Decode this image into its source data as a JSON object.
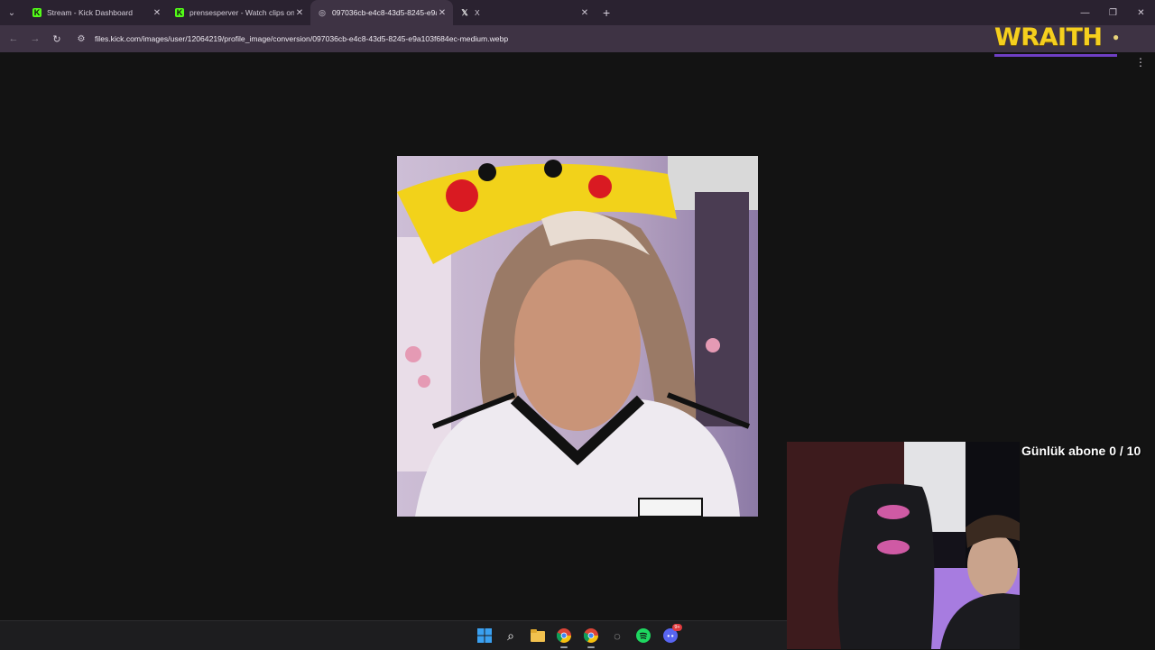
{
  "browser": {
    "tabs": [
      {
        "title": "Stream - Kick Dashboard",
        "favicon": "kick-icon",
        "active": false
      },
      {
        "title": "prensesperver - Watch clips on",
        "favicon": "kick-icon",
        "active": false
      },
      {
        "title": "097036cb-e4c8-43d5-8245-e9a",
        "favicon": "globe-icon",
        "active": true
      },
      {
        "title": "X",
        "favicon": "x-icon",
        "active": false
      }
    ],
    "url": "files.kick.com/images/user/12064219/profile_image/conversion/097036cb-e4c8-43d5-8245-e9a103f684ec-medium.webp"
  },
  "overlay": {
    "brand_logo": "WRAITH",
    "sub_goal": "Günlük abone 0 / 10"
  },
  "icons": {
    "tab_search": "chevron-down-icon",
    "back": "arrow-left-icon",
    "forward": "arrow-right-icon",
    "reload": "reload-icon",
    "site_info": "tune-icon",
    "menu": "kebab-menu-icon"
  },
  "taskbar": {
    "items": [
      "windows-start-icon",
      "search-icon",
      "file-explorer-icon",
      "chrome-icon",
      "chrome-icon",
      "app-icon",
      "spotify-icon",
      "discord-icon"
    ],
    "discord_badge": "9+"
  },
  "colors": {
    "tabstrip": "#2a2230",
    "toolbar": "#3e3344",
    "page_bg": "#131313",
    "kick_green": "#53fc18",
    "wraith_yellow": "#f5cf1e"
  }
}
